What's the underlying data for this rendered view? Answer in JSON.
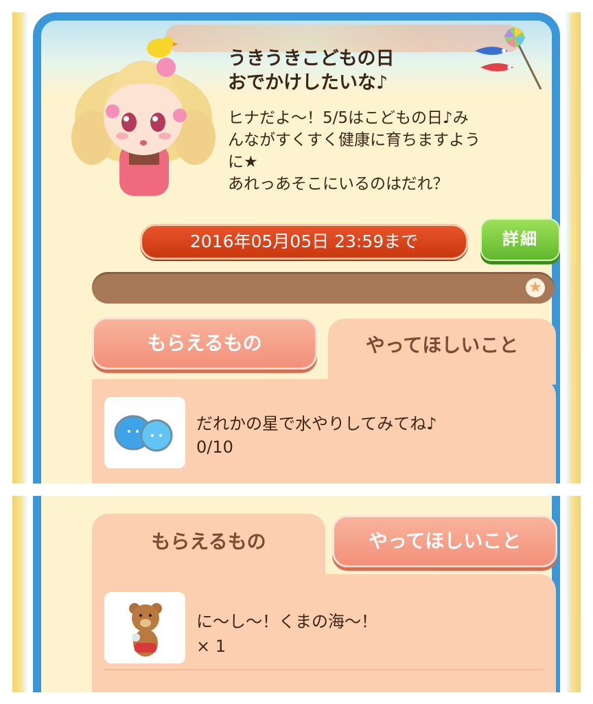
{
  "event": {
    "title": "うきうきこどもの日\nおでかけしたいな♪",
    "description": "ヒナだよ〜！5/5はこどもの日♪み\nんながすくすく健康に育ちますよう\nに★\nあれっあそこにいるのはだれ？",
    "deadline": "2016年05月05日 23:59まで",
    "detail_button": "詳細"
  },
  "tabs": {
    "rewards": "もらえるもの",
    "tasks": "やってほしいこと"
  },
  "task": {
    "text": "だれかの星で水やりしてみてね♪",
    "progress_text": "0/10",
    "progress": 0
  },
  "reward": {
    "text": "に〜し〜！くまの海〜！",
    "quantity": "× 1"
  },
  "colors": {
    "frame": "#3a98d8",
    "deadline": "#d9441a",
    "detail_button": "#6cc23a",
    "progress_track": "#a77957",
    "tab_active": "#fbcfb0",
    "tab_inactive": "#f3907a"
  }
}
